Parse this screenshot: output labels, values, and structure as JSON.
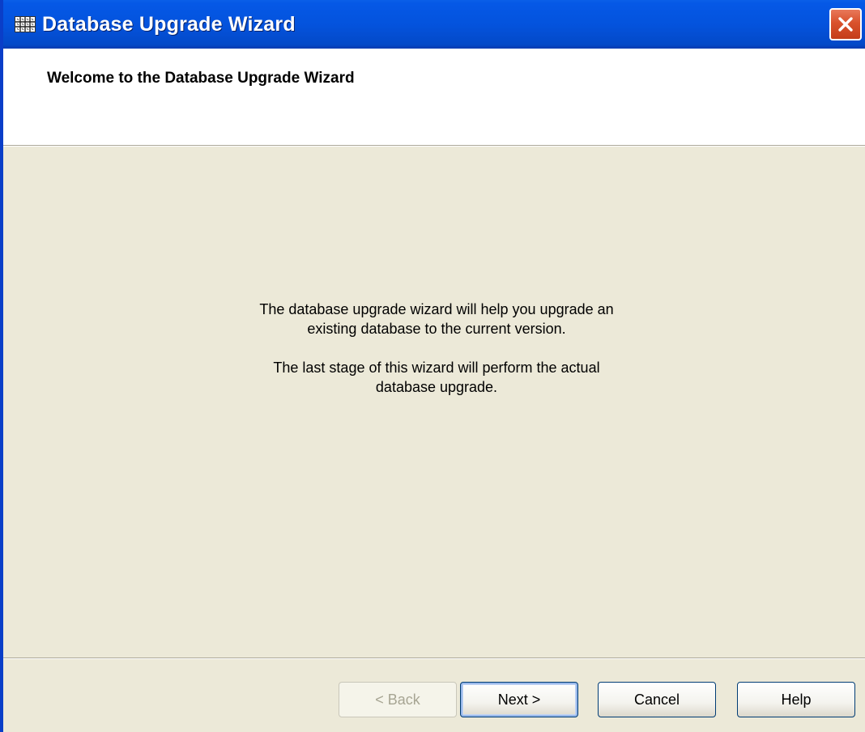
{
  "window": {
    "title": "Database Upgrade Wizard",
    "icon": "database-grid-icon",
    "close_icon": "close-icon"
  },
  "header": {
    "title": "Welcome to the Database Upgrade Wizard"
  },
  "body": {
    "paragraph1_line1": "The database upgrade wizard will help you upgrade an",
    "paragraph1_line2": "existing database to the current version.",
    "paragraph2_line1": "The last stage of this wizard will perform the actual",
    "paragraph2_line2": "database upgrade."
  },
  "buttons": {
    "back_label": "< Back",
    "next_label": "Next >",
    "cancel_label": "Cancel",
    "help_label": "Help"
  },
  "colors": {
    "titlebar": "#0453dd",
    "dialog_background": "#ece9d8",
    "header_background": "#ffffff",
    "close_button": "#d9512c"
  }
}
